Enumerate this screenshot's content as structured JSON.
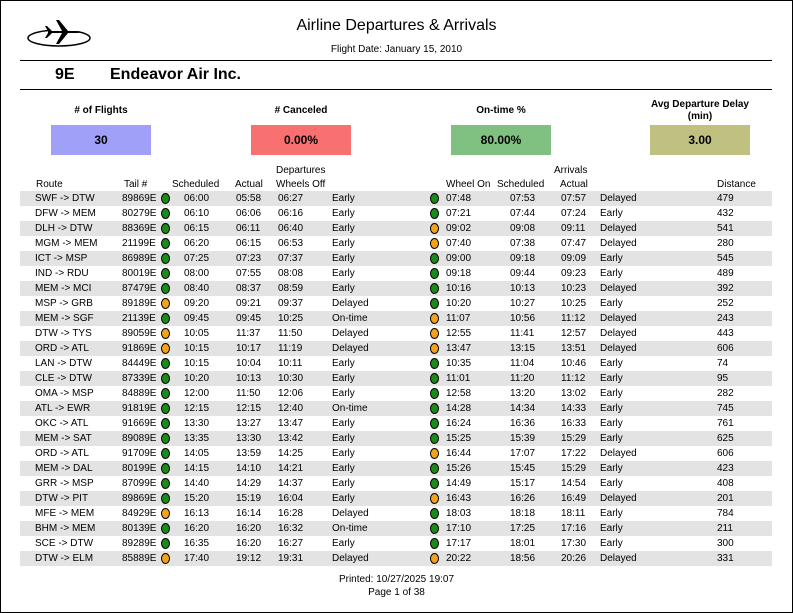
{
  "report": {
    "title": "Airline Departures & Arrivals",
    "flight_date": "Flight Date: January 15, 2010",
    "carrier_code": "9E",
    "carrier_name": "Endeavor Air Inc."
  },
  "stats": [
    {
      "label": "# of Flights",
      "value": "30",
      "color": "#a0a0f8"
    },
    {
      "label": "# Canceled",
      "value": "0.00%",
      "color": "#f87070"
    },
    {
      "label": "On-time %",
      "value": "80.00%",
      "color": "#80c080"
    },
    {
      "label": "Avg Departure Delay (min)",
      "value": "3.00",
      "color": "#c0c080"
    }
  ],
  "headers": {
    "departures": "Departures",
    "arrivals": "Arrivals",
    "route": "Route",
    "tail": "Tail #",
    "dep_scheduled": "Scheduled",
    "dep_actual": "Actual",
    "wheels_off": "Wheels Off",
    "wheels_on": "Wheel On",
    "arr_scheduled": "Scheduled",
    "arr_actual": "Actual",
    "distance": "Distance"
  },
  "status_colors": {
    "green": "#1a8a1a",
    "orange": "#f4a21a"
  },
  "flights": [
    {
      "route": "SWF -> DTW",
      "tail": "89869E",
      "dep_dot": "green",
      "dep_sched": "06:00",
      "dep_actual": "05:58",
      "wheels_off": "06:27",
      "dep_status": "Early",
      "arr_dot": "green",
      "wheels_on": "07:48",
      "arr_sched": "07:53",
      "arr_actual": "07:57",
      "arr_status": "Delayed",
      "distance": "479"
    },
    {
      "route": "DFW -> MEM",
      "tail": "80279E",
      "dep_dot": "green",
      "dep_sched": "06:10",
      "dep_actual": "06:06",
      "wheels_off": "06:16",
      "dep_status": "Early",
      "arr_dot": "green",
      "wheels_on": "07:21",
      "arr_sched": "07:44",
      "arr_actual": "07:24",
      "arr_status": "Early",
      "distance": "432"
    },
    {
      "route": "DLH -> DTW",
      "tail": "88369E",
      "dep_dot": "green",
      "dep_sched": "06:15",
      "dep_actual": "06:11",
      "wheels_off": "06:40",
      "dep_status": "Early",
      "arr_dot": "orange",
      "wheels_on": "09:02",
      "arr_sched": "09:08",
      "arr_actual": "09:11",
      "arr_status": "Delayed",
      "distance": "541"
    },
    {
      "route": "MGM -> MEM",
      "tail": "21199E",
      "dep_dot": "green",
      "dep_sched": "06:20",
      "dep_actual": "06:15",
      "wheels_off": "06:53",
      "dep_status": "Early",
      "arr_dot": "orange",
      "wheels_on": "07:40",
      "arr_sched": "07:38",
      "arr_actual": "07:47",
      "arr_status": "Delayed",
      "distance": "280"
    },
    {
      "route": "ICT -> MSP",
      "tail": "86989E",
      "dep_dot": "green",
      "dep_sched": "07:25",
      "dep_actual": "07:23",
      "wheels_off": "07:37",
      "dep_status": "Early",
      "arr_dot": "green",
      "wheels_on": "09:00",
      "arr_sched": "09:18",
      "arr_actual": "09:09",
      "arr_status": "Early",
      "distance": "545"
    },
    {
      "route": "IND -> RDU",
      "tail": "80019E",
      "dep_dot": "green",
      "dep_sched": "08:00",
      "dep_actual": "07:55",
      "wheels_off": "08:08",
      "dep_status": "Early",
      "arr_dot": "green",
      "wheels_on": "09:18",
      "arr_sched": "09:44",
      "arr_actual": "09:23",
      "arr_status": "Early",
      "distance": "489"
    },
    {
      "route": "MEM -> MCI",
      "tail": "87479E",
      "dep_dot": "green",
      "dep_sched": "08:40",
      "dep_actual": "08:37",
      "wheels_off": "08:59",
      "dep_status": "Early",
      "arr_dot": "green",
      "wheels_on": "10:16",
      "arr_sched": "10:13",
      "arr_actual": "10:23",
      "arr_status": "Delayed",
      "distance": "392"
    },
    {
      "route": "MSP -> GRB",
      "tail": "89189E",
      "dep_dot": "orange",
      "dep_sched": "09:20",
      "dep_actual": "09:21",
      "wheels_off": "09:37",
      "dep_status": "Delayed",
      "arr_dot": "green",
      "wheels_on": "10:20",
      "arr_sched": "10:27",
      "arr_actual": "10:25",
      "arr_status": "Early",
      "distance": "252"
    },
    {
      "route": "MEM -> SGF",
      "tail": "21139E",
      "dep_dot": "green",
      "dep_sched": "09:45",
      "dep_actual": "09:45",
      "wheels_off": "10:25",
      "dep_status": "On-time",
      "arr_dot": "orange",
      "wheels_on": "11:07",
      "arr_sched": "10:56",
      "arr_actual": "11:12",
      "arr_status": "Delayed",
      "distance": "243"
    },
    {
      "route": "DTW -> TYS",
      "tail": "89059E",
      "dep_dot": "orange",
      "dep_sched": "10:05",
      "dep_actual": "11:37",
      "wheels_off": "11:50",
      "dep_status": "Delayed",
      "arr_dot": "orange",
      "wheels_on": "12:55",
      "arr_sched": "11:41",
      "arr_actual": "12:57",
      "arr_status": "Delayed",
      "distance": "443"
    },
    {
      "route": "ORD -> ATL",
      "tail": "91869E",
      "dep_dot": "orange",
      "dep_sched": "10:15",
      "dep_actual": "10:17",
      "wheels_off": "11:19",
      "dep_status": "Delayed",
      "arr_dot": "orange",
      "wheels_on": "13:47",
      "arr_sched": "13:15",
      "arr_actual": "13:51",
      "arr_status": "Delayed",
      "distance": "606"
    },
    {
      "route": "LAN -> DTW",
      "tail": "84449E",
      "dep_dot": "green",
      "dep_sched": "10:15",
      "dep_actual": "10:04",
      "wheels_off": "10:11",
      "dep_status": "Early",
      "arr_dot": "green",
      "wheels_on": "10:35",
      "arr_sched": "11:04",
      "arr_actual": "10:46",
      "arr_status": "Early",
      "distance": "74"
    },
    {
      "route": "CLE -> DTW",
      "tail": "87339E",
      "dep_dot": "green",
      "dep_sched": "10:20",
      "dep_actual": "10:13",
      "wheels_off": "10:30",
      "dep_status": "Early",
      "arr_dot": "green",
      "wheels_on": "11:01",
      "arr_sched": "11:20",
      "arr_actual": "11:12",
      "arr_status": "Early",
      "distance": "95"
    },
    {
      "route": "OMA -> MSP",
      "tail": "84889E",
      "dep_dot": "green",
      "dep_sched": "12:00",
      "dep_actual": "11:50",
      "wheels_off": "12:06",
      "dep_status": "Early",
      "arr_dot": "green",
      "wheels_on": "12:58",
      "arr_sched": "13:20",
      "arr_actual": "13:02",
      "arr_status": "Early",
      "distance": "282"
    },
    {
      "route": "ATL -> EWR",
      "tail": "91819E",
      "dep_dot": "green",
      "dep_sched": "12:15",
      "dep_actual": "12:15",
      "wheels_off": "12:40",
      "dep_status": "On-time",
      "arr_dot": "green",
      "wheels_on": "14:28",
      "arr_sched": "14:34",
      "arr_actual": "14:33",
      "arr_status": "Early",
      "distance": "745"
    },
    {
      "route": "OKC -> ATL",
      "tail": "91669E",
      "dep_dot": "green",
      "dep_sched": "13:30",
      "dep_actual": "13:27",
      "wheels_off": "13:47",
      "dep_status": "Early",
      "arr_dot": "green",
      "wheels_on": "16:24",
      "arr_sched": "16:36",
      "arr_actual": "16:33",
      "arr_status": "Early",
      "distance": "761"
    },
    {
      "route": "MEM -> SAT",
      "tail": "89089E",
      "dep_dot": "green",
      "dep_sched": "13:35",
      "dep_actual": "13:30",
      "wheels_off": "13:42",
      "dep_status": "Early",
      "arr_dot": "green",
      "wheels_on": "15:25",
      "arr_sched": "15:39",
      "arr_actual": "15:29",
      "arr_status": "Early",
      "distance": "625"
    },
    {
      "route": "ORD -> ATL",
      "tail": "91709E",
      "dep_dot": "green",
      "dep_sched": "14:05",
      "dep_actual": "13:59",
      "wheels_off": "14:25",
      "dep_status": "Early",
      "arr_dot": "orange",
      "wheels_on": "16:44",
      "arr_sched": "17:07",
      "arr_actual": "17:22",
      "arr_status": "Delayed",
      "distance": "606"
    },
    {
      "route": "MEM -> DAL",
      "tail": "80199E",
      "dep_dot": "green",
      "dep_sched": "14:15",
      "dep_actual": "14:10",
      "wheels_off": "14:21",
      "dep_status": "Early",
      "arr_dot": "green",
      "wheels_on": "15:26",
      "arr_sched": "15:45",
      "arr_actual": "15:29",
      "arr_status": "Early",
      "distance": "423"
    },
    {
      "route": "GRR -> MSP",
      "tail": "87099E",
      "dep_dot": "green",
      "dep_sched": "14:40",
      "dep_actual": "14:29",
      "wheels_off": "14:37",
      "dep_status": "Early",
      "arr_dot": "green",
      "wheels_on": "14:49",
      "arr_sched": "15:17",
      "arr_actual": "14:54",
      "arr_status": "Early",
      "distance": "408"
    },
    {
      "route": "DTW -> PIT",
      "tail": "89869E",
      "dep_dot": "green",
      "dep_sched": "15:20",
      "dep_actual": "15:19",
      "wheels_off": "16:04",
      "dep_status": "Early",
      "arr_dot": "orange",
      "wheels_on": "16:43",
      "arr_sched": "16:26",
      "arr_actual": "16:49",
      "arr_status": "Delayed",
      "distance": "201"
    },
    {
      "route": "MFE -> MEM",
      "tail": "84929E",
      "dep_dot": "orange",
      "dep_sched": "16:13",
      "dep_actual": "16:14",
      "wheels_off": "16:28",
      "dep_status": "Delayed",
      "arr_dot": "green",
      "wheels_on": "18:03",
      "arr_sched": "18:18",
      "arr_actual": "18:11",
      "arr_status": "Early",
      "distance": "784"
    },
    {
      "route": "BHM -> MEM",
      "tail": "80139E",
      "dep_dot": "green",
      "dep_sched": "16:20",
      "dep_actual": "16:20",
      "wheels_off": "16:32",
      "dep_status": "On-time",
      "arr_dot": "green",
      "wheels_on": "17:10",
      "arr_sched": "17:25",
      "arr_actual": "17:16",
      "arr_status": "Early",
      "distance": "211"
    },
    {
      "route": "SCE -> DTW",
      "tail": "89289E",
      "dep_dot": "green",
      "dep_sched": "16:35",
      "dep_actual": "16:20",
      "wheels_off": "16:27",
      "dep_status": "Early",
      "arr_dot": "green",
      "wheels_on": "17:17",
      "arr_sched": "18:01",
      "arr_actual": "17:30",
      "arr_status": "Early",
      "distance": "300"
    },
    {
      "route": "DTW -> ELM",
      "tail": "85889E",
      "dep_dot": "orange",
      "dep_sched": "17:40",
      "dep_actual": "19:12",
      "wheels_off": "19:31",
      "dep_status": "Delayed",
      "arr_dot": "orange",
      "wheels_on": "20:22",
      "arr_sched": "18:56",
      "arr_actual": "20:26",
      "arr_status": "Delayed",
      "distance": "331"
    }
  ],
  "footer": {
    "printed": "Printed: 10/27/2025 19:07",
    "page": "Page 1 of 38"
  }
}
